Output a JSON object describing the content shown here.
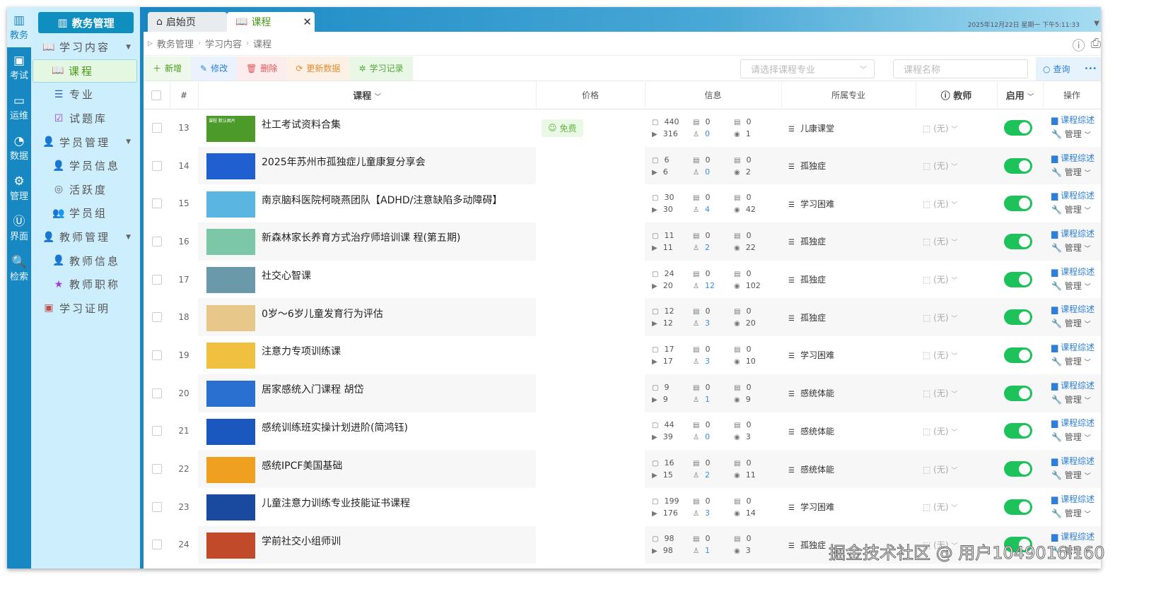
{
  "rail": [
    {
      "icon": "books-icon",
      "label": "教务"
    },
    {
      "icon": "exam-icon",
      "label": "考试"
    },
    {
      "icon": "ops-icon",
      "label": "运维"
    },
    {
      "icon": "chart-icon",
      "label": "数据"
    },
    {
      "icon": "gear-icon",
      "label": "管理"
    },
    {
      "icon": "ui-icon",
      "label": "界面"
    },
    {
      "icon": "search-icon",
      "label": "检索"
    }
  ],
  "sidebar": {
    "title": "教务管理",
    "items": [
      {
        "label": "学习内容",
        "level": 1,
        "icon": "book-icon",
        "glyph": "📖",
        "color": "#4a9a1a",
        "expand": true
      },
      {
        "label": "课程",
        "level": 2,
        "icon": "book-icon",
        "glyph": "📖",
        "color": "#4a9a1a",
        "selected": true
      },
      {
        "label": "专业",
        "level": 2,
        "icon": "layers-icon",
        "glyph": "☰",
        "color": "#2a5fb0"
      },
      {
        "label": "试题库",
        "level": 2,
        "icon": "quiz-icon",
        "glyph": "☑",
        "color": "#9b3fd8"
      },
      {
        "label": "学员管理",
        "level": 1,
        "icon": "user-icon",
        "glyph": "👤",
        "color": "#e05a3a",
        "expand": true
      },
      {
        "label": "学员信息",
        "level": 2,
        "icon": "user-info-icon",
        "glyph": "👤",
        "color": "#2a9a3a"
      },
      {
        "label": "活跃度",
        "level": 2,
        "icon": "activity-icon",
        "glyph": "◎",
        "color": "#666"
      },
      {
        "label": "学员组",
        "level": 2,
        "icon": "group-icon",
        "glyph": "👥",
        "color": "#3a4ad8"
      },
      {
        "label": "教师管理",
        "level": 1,
        "icon": "teacher-icon",
        "glyph": "👤",
        "color": "#4a7ab0",
        "expand": true
      },
      {
        "label": "教师信息",
        "level": 2,
        "icon": "teacher-info-icon",
        "glyph": "👤",
        "color": "#3a9a5a"
      },
      {
        "label": "教师职称",
        "level": 2,
        "icon": "teacher-title-icon",
        "glyph": "★",
        "color": "#a03ad8"
      },
      {
        "label": "学习证明",
        "level": 1,
        "icon": "certificate-icon",
        "glyph": "▣",
        "color": "#c0504a"
      }
    ]
  },
  "tabs": {
    "home": "启始页",
    "course": "课程"
  },
  "clock": "2025年12月22日 星期一 下午5:11:33",
  "breadcrumb": [
    "教务管理",
    "学习内容",
    "课程"
  ],
  "toolbar": {
    "add": "新增",
    "edit": "修改",
    "delete": "删除",
    "refresh": "更新数据",
    "records": "学习记录",
    "major_placeholder": "请选择课程专业",
    "name_placeholder": "课程名称",
    "query": "查询"
  },
  "columns": {
    "index": "#",
    "course": "课程",
    "price": "价格",
    "info": "信息",
    "major": "所属专业",
    "teacher": "教师",
    "enable": "启用",
    "ops": "操作"
  },
  "row_labels": {
    "free": "免费",
    "teacher_none": "(无)",
    "overview": "课程综述",
    "manage": "管理"
  },
  "rows": [
    {
      "id": "13",
      "title": "社工考试资料合集",
      "free": true,
      "a": "440",
      "b": "316",
      "c": "0",
      "d": "0",
      "e": "0",
      "f": "1",
      "major": "儿康课堂",
      "thumb": "#4c9a2a",
      "thumbText": "课程 默认图片"
    },
    {
      "id": "14",
      "title": "2025年苏州市孤独症儿童康复分享会",
      "a": "6",
      "b": "6",
      "c": "0",
      "d": "0",
      "e": "0",
      "f": "2",
      "major": "孤独症",
      "thumb": "#1f5fd0"
    },
    {
      "id": "15",
      "title": "南京脑科医院柯晓燕团队【ADHD/注意缺陷多动障碍】",
      "a": "30",
      "b": "30",
      "c": "0",
      "d": "4",
      "e": "0",
      "f": "42",
      "major": "学习困难",
      "thumb": "#5ab6e0"
    },
    {
      "id": "16",
      "title": "新森林家长养育方式治疗师培训课 程(第五期)",
      "a": "11",
      "b": "11",
      "c": "0",
      "d": "2",
      "e": "0",
      "f": "22",
      "major": "孤独症",
      "thumb": "#7cc7a8"
    },
    {
      "id": "17",
      "title": "社交心智课",
      "a": "24",
      "b": "20",
      "c": "0",
      "d": "12",
      "e": "0",
      "f": "102",
      "major": "孤独症",
      "thumb": "#6a9aaa"
    },
    {
      "id": "18",
      "title": "0岁～6岁儿童发育行为评估",
      "a": "12",
      "b": "12",
      "c": "0",
      "d": "3",
      "e": "0",
      "f": "20",
      "major": "孤独症",
      "thumb": "#e8c88a"
    },
    {
      "id": "19",
      "title": "注意力专项训练课",
      "a": "17",
      "b": "17",
      "c": "0",
      "d": "3",
      "e": "0",
      "f": "10",
      "major": "学习困难",
      "thumb": "#f0c040"
    },
    {
      "id": "20",
      "title": "居家感统入门课程 胡岱",
      "a": "9",
      "b": "9",
      "c": "0",
      "d": "1",
      "e": "0",
      "f": "9",
      "major": "感统体能",
      "thumb": "#2a70d0"
    },
    {
      "id": "21",
      "title": "感统训练班实操计划进阶(简鸿钰)",
      "a": "44",
      "b": "39",
      "c": "0",
      "d": "0",
      "e": "0",
      "f": "3",
      "major": "感统体能",
      "thumb": "#1a58c0"
    },
    {
      "id": "22",
      "title": "感统IPCF美国基础",
      "a": "16",
      "b": "15",
      "c": "0",
      "d": "2",
      "e": "0",
      "f": "11",
      "major": "感统体能",
      "thumb": "#f0a020"
    },
    {
      "id": "23",
      "title": "儿童注意力训练专业技能证书课程",
      "a": "199",
      "b": "176",
      "c": "0",
      "d": "3",
      "e": "0",
      "f": "14",
      "major": "学习困难",
      "thumb": "#1a4aa0"
    },
    {
      "id": "24",
      "title": "学前社交小组师训",
      "a": "98",
      "b": "98",
      "c": "0",
      "d": "1",
      "e": "0",
      "f": "3",
      "major": "孤独症",
      "thumb": "#c04a2a"
    }
  ],
  "watermark": "掘金技术社区 @ 用户1049016l160"
}
